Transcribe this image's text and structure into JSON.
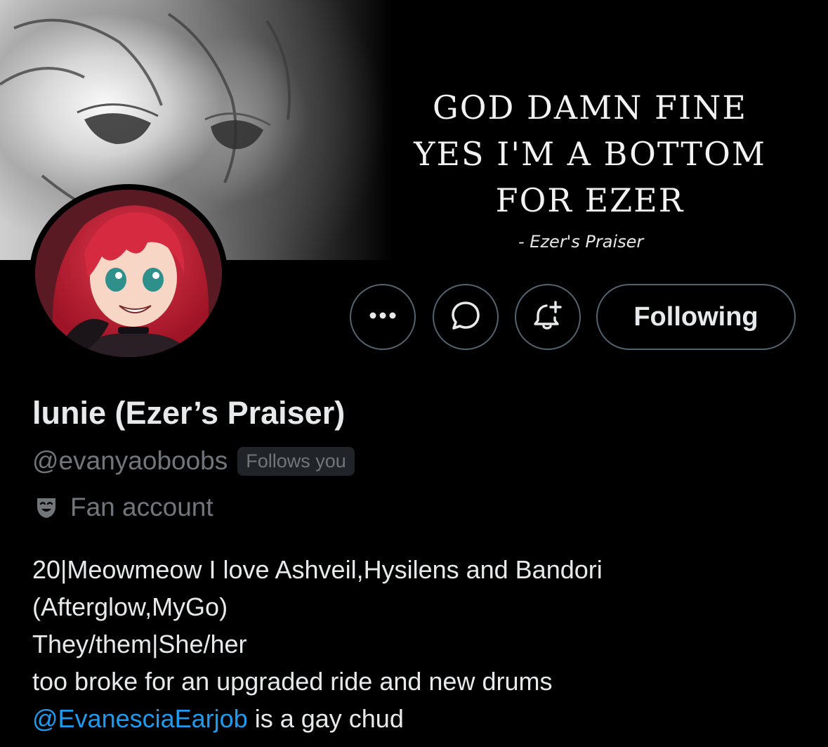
{
  "banner": {
    "quote_lines": [
      "GOD DAMN FINE",
      "YES I'M A BOTTOM",
      "FOR EZER"
    ],
    "attribution": "- Ezer's Praiser"
  },
  "actions": {
    "more_icon": "more-horizontal-icon",
    "message_icon": "message-bubble-icon",
    "notify_icon": "bell-plus-icon",
    "following_label": "Following"
  },
  "profile": {
    "display_name": "lunie (Ezer’s Praiser)",
    "handle": "@evanyaoboobs",
    "follows_you": "Follows you",
    "category_icon": "theater-masks-icon",
    "category": "Fan account",
    "bio": {
      "line1": "20|Meowmeow I love Ashveil,Hysilens and Bandori",
      "line2": "(Afterglow,MyGo)",
      "line3": "They/them|She/her",
      "line4": "too broke for an upgraded ride and new drums",
      "mention": "@EvanesciaEarjob",
      "line5_rest": " is a gay chud"
    }
  },
  "colors": {
    "background": "#000000",
    "text_primary": "#e7e9ea",
    "text_secondary": "#71767b",
    "button_border": "#536471",
    "link": "#1d9bf0"
  }
}
